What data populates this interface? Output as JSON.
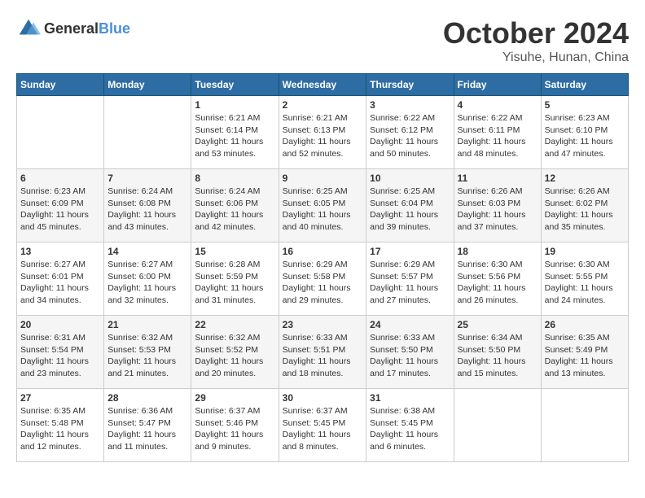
{
  "logo": {
    "general": "General",
    "blue": "Blue"
  },
  "title": "October 2024",
  "location": "Yisuhe, Hunan, China",
  "weekdays": [
    "Sunday",
    "Monday",
    "Tuesday",
    "Wednesday",
    "Thursday",
    "Friday",
    "Saturday"
  ],
  "weeks": [
    [
      {
        "day": "",
        "sunrise": "",
        "sunset": "",
        "daylight": ""
      },
      {
        "day": "",
        "sunrise": "",
        "sunset": "",
        "daylight": ""
      },
      {
        "day": "1",
        "sunrise": "Sunrise: 6:21 AM",
        "sunset": "Sunset: 6:14 PM",
        "daylight": "Daylight: 11 hours and 53 minutes."
      },
      {
        "day": "2",
        "sunrise": "Sunrise: 6:21 AM",
        "sunset": "Sunset: 6:13 PM",
        "daylight": "Daylight: 11 hours and 52 minutes."
      },
      {
        "day": "3",
        "sunrise": "Sunrise: 6:22 AM",
        "sunset": "Sunset: 6:12 PM",
        "daylight": "Daylight: 11 hours and 50 minutes."
      },
      {
        "day": "4",
        "sunrise": "Sunrise: 6:22 AM",
        "sunset": "Sunset: 6:11 PM",
        "daylight": "Daylight: 11 hours and 48 minutes."
      },
      {
        "day": "5",
        "sunrise": "Sunrise: 6:23 AM",
        "sunset": "Sunset: 6:10 PM",
        "daylight": "Daylight: 11 hours and 47 minutes."
      }
    ],
    [
      {
        "day": "6",
        "sunrise": "Sunrise: 6:23 AM",
        "sunset": "Sunset: 6:09 PM",
        "daylight": "Daylight: 11 hours and 45 minutes."
      },
      {
        "day": "7",
        "sunrise": "Sunrise: 6:24 AM",
        "sunset": "Sunset: 6:08 PM",
        "daylight": "Daylight: 11 hours and 43 minutes."
      },
      {
        "day": "8",
        "sunrise": "Sunrise: 6:24 AM",
        "sunset": "Sunset: 6:06 PM",
        "daylight": "Daylight: 11 hours and 42 minutes."
      },
      {
        "day": "9",
        "sunrise": "Sunrise: 6:25 AM",
        "sunset": "Sunset: 6:05 PM",
        "daylight": "Daylight: 11 hours and 40 minutes."
      },
      {
        "day": "10",
        "sunrise": "Sunrise: 6:25 AM",
        "sunset": "Sunset: 6:04 PM",
        "daylight": "Daylight: 11 hours and 39 minutes."
      },
      {
        "day": "11",
        "sunrise": "Sunrise: 6:26 AM",
        "sunset": "Sunset: 6:03 PM",
        "daylight": "Daylight: 11 hours and 37 minutes."
      },
      {
        "day": "12",
        "sunrise": "Sunrise: 6:26 AM",
        "sunset": "Sunset: 6:02 PM",
        "daylight": "Daylight: 11 hours and 35 minutes."
      }
    ],
    [
      {
        "day": "13",
        "sunrise": "Sunrise: 6:27 AM",
        "sunset": "Sunset: 6:01 PM",
        "daylight": "Daylight: 11 hours and 34 minutes."
      },
      {
        "day": "14",
        "sunrise": "Sunrise: 6:27 AM",
        "sunset": "Sunset: 6:00 PM",
        "daylight": "Daylight: 11 hours and 32 minutes."
      },
      {
        "day": "15",
        "sunrise": "Sunrise: 6:28 AM",
        "sunset": "Sunset: 5:59 PM",
        "daylight": "Daylight: 11 hours and 31 minutes."
      },
      {
        "day": "16",
        "sunrise": "Sunrise: 6:29 AM",
        "sunset": "Sunset: 5:58 PM",
        "daylight": "Daylight: 11 hours and 29 minutes."
      },
      {
        "day": "17",
        "sunrise": "Sunrise: 6:29 AM",
        "sunset": "Sunset: 5:57 PM",
        "daylight": "Daylight: 11 hours and 27 minutes."
      },
      {
        "day": "18",
        "sunrise": "Sunrise: 6:30 AM",
        "sunset": "Sunset: 5:56 PM",
        "daylight": "Daylight: 11 hours and 26 minutes."
      },
      {
        "day": "19",
        "sunrise": "Sunrise: 6:30 AM",
        "sunset": "Sunset: 5:55 PM",
        "daylight": "Daylight: 11 hours and 24 minutes."
      }
    ],
    [
      {
        "day": "20",
        "sunrise": "Sunrise: 6:31 AM",
        "sunset": "Sunset: 5:54 PM",
        "daylight": "Daylight: 11 hours and 23 minutes."
      },
      {
        "day": "21",
        "sunrise": "Sunrise: 6:32 AM",
        "sunset": "Sunset: 5:53 PM",
        "daylight": "Daylight: 11 hours and 21 minutes."
      },
      {
        "day": "22",
        "sunrise": "Sunrise: 6:32 AM",
        "sunset": "Sunset: 5:52 PM",
        "daylight": "Daylight: 11 hours and 20 minutes."
      },
      {
        "day": "23",
        "sunrise": "Sunrise: 6:33 AM",
        "sunset": "Sunset: 5:51 PM",
        "daylight": "Daylight: 11 hours and 18 minutes."
      },
      {
        "day": "24",
        "sunrise": "Sunrise: 6:33 AM",
        "sunset": "Sunset: 5:50 PM",
        "daylight": "Daylight: 11 hours and 17 minutes."
      },
      {
        "day": "25",
        "sunrise": "Sunrise: 6:34 AM",
        "sunset": "Sunset: 5:50 PM",
        "daylight": "Daylight: 11 hours and 15 minutes."
      },
      {
        "day": "26",
        "sunrise": "Sunrise: 6:35 AM",
        "sunset": "Sunset: 5:49 PM",
        "daylight": "Daylight: 11 hours and 13 minutes."
      }
    ],
    [
      {
        "day": "27",
        "sunrise": "Sunrise: 6:35 AM",
        "sunset": "Sunset: 5:48 PM",
        "daylight": "Daylight: 11 hours and 12 minutes."
      },
      {
        "day": "28",
        "sunrise": "Sunrise: 6:36 AM",
        "sunset": "Sunset: 5:47 PM",
        "daylight": "Daylight: 11 hours and 11 minutes."
      },
      {
        "day": "29",
        "sunrise": "Sunrise: 6:37 AM",
        "sunset": "Sunset: 5:46 PM",
        "daylight": "Daylight: 11 hours and 9 minutes."
      },
      {
        "day": "30",
        "sunrise": "Sunrise: 6:37 AM",
        "sunset": "Sunset: 5:45 PM",
        "daylight": "Daylight: 11 hours and 8 minutes."
      },
      {
        "day": "31",
        "sunrise": "Sunrise: 6:38 AM",
        "sunset": "Sunset: 5:45 PM",
        "daylight": "Daylight: 11 hours and 6 minutes."
      },
      {
        "day": "",
        "sunrise": "",
        "sunset": "",
        "daylight": ""
      },
      {
        "day": "",
        "sunrise": "",
        "sunset": "",
        "daylight": ""
      }
    ]
  ]
}
